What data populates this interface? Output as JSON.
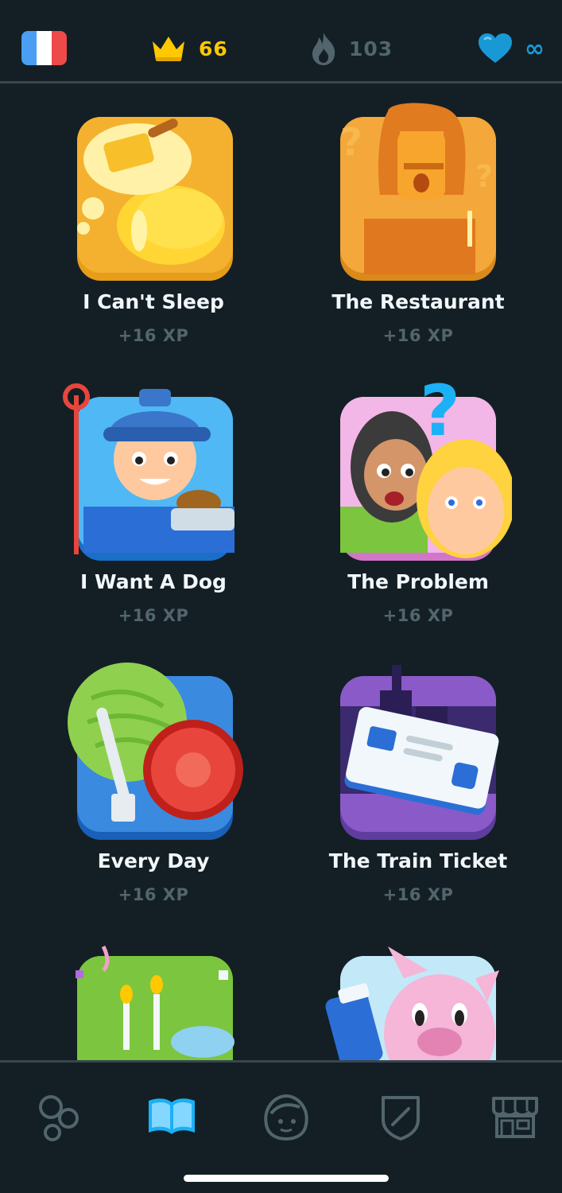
{
  "topbar": {
    "language": "French",
    "crowns": "66",
    "streak": "103",
    "hearts": "∞",
    "colors": {
      "crown": "#ffc800",
      "streak_inactive": "#52656d",
      "heart": "#1899d6"
    }
  },
  "stories": [
    {
      "title": "I Can't Sleep",
      "xp": "+16 XP"
    },
    {
      "title": "The Restaurant",
      "xp": "+16 XP"
    },
    {
      "title": "I Want A Dog",
      "xp": "+16 XP"
    },
    {
      "title": "The Problem",
      "xp": "+16 XP"
    },
    {
      "title": "Every Day",
      "xp": "+16 XP"
    },
    {
      "title": "The Train Ticket",
      "xp": "+16 XP"
    }
  ],
  "nav": {
    "items": [
      {
        "icon": "learn-circles-icon",
        "active": false
      },
      {
        "icon": "stories-book-icon",
        "active": true
      },
      {
        "icon": "profile-face-icon",
        "active": false
      },
      {
        "icon": "leagues-shield-icon",
        "active": false
      },
      {
        "icon": "shop-icon",
        "active": false
      }
    ],
    "active_color": "#1cb0f6"
  }
}
